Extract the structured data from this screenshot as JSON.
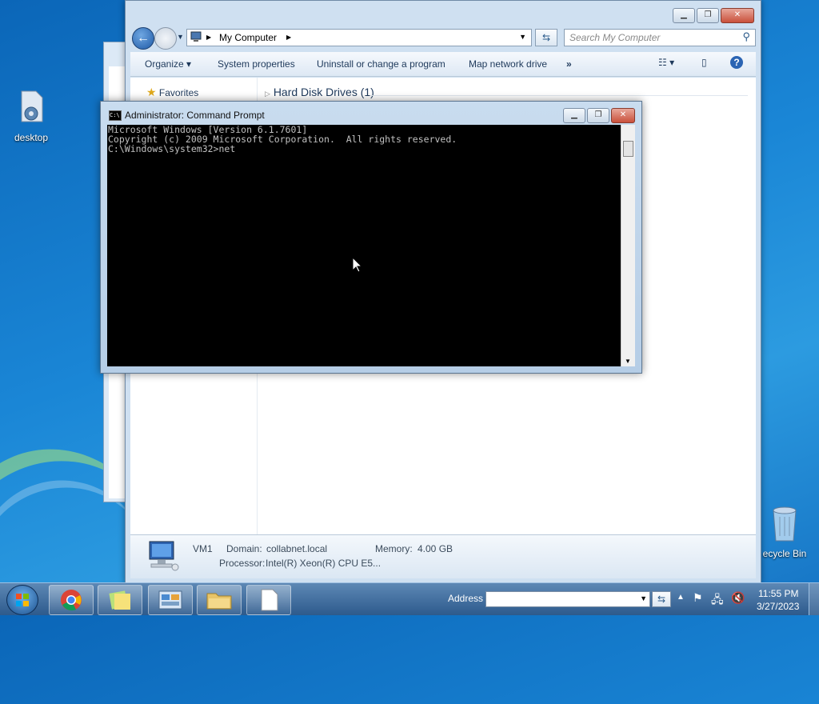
{
  "desktop": {
    "icons": [
      {
        "label": "desktop"
      },
      {
        "label": "ecycle Bin"
      }
    ]
  },
  "explorer": {
    "breadcrumb": "My Computer",
    "search_placeholder": "Search My Computer",
    "toolbar": {
      "organize": "Organize",
      "system_properties": "System properties",
      "uninstall": "Uninstall or change a program",
      "map_drive": "Map network drive",
      "more": "»"
    },
    "nav": {
      "favorites": "Favorites"
    },
    "group_header": "Hard Disk Drives (1)",
    "details": {
      "name": "VM1",
      "domain_label": "Domain:",
      "domain_value": "collabnet.local",
      "memory_label": "Memory:",
      "memory_value": "4.00 GB",
      "processor_label": "Processor:",
      "processor_value": "Intel(R) Xeon(R) CPU E5..."
    }
  },
  "cmd": {
    "title": "Administrator: Command Prompt",
    "lines": [
      "Microsoft Windows [Version 6.1.7601]",
      "Copyright (c) 2009 Microsoft Corporation.  All rights reserved.",
      "",
      "C:\\Windows\\system32>net"
    ]
  },
  "taskbar": {
    "address_label": "Address",
    "time": "11:55 PM",
    "date": "3/27/2023"
  }
}
